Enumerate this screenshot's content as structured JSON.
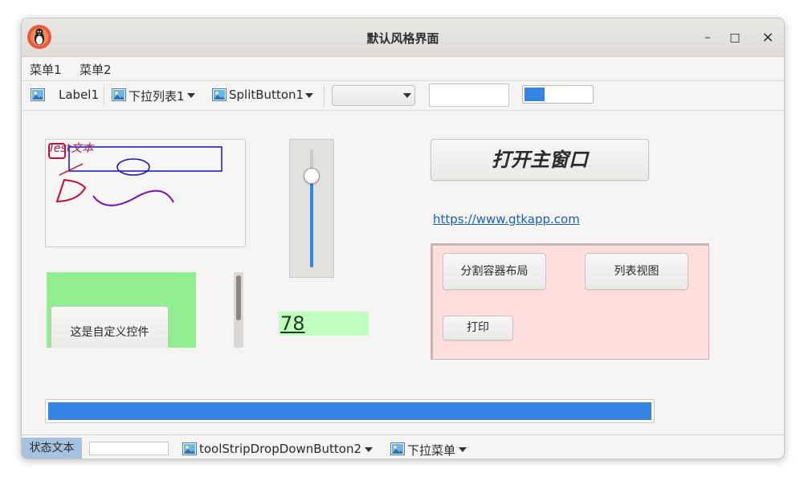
{
  "window": {
    "title": "默认风格界面",
    "minimize_glyph": "–",
    "maximize_glyph": "□",
    "close_glyph": "×"
  },
  "menubar": {
    "items": [
      "菜单1",
      "菜单2"
    ]
  },
  "toolbar": {
    "label1": "Label1",
    "dropdown1": "下拉列表1",
    "split_button1": "SplitButton1",
    "combo_value": "",
    "text_value": "",
    "progress_value": 0.3
  },
  "canvas": {
    "text": "Test文本"
  },
  "main_button": {
    "label": "打开主窗口"
  },
  "link": {
    "text": "https://www.gtkapp.com"
  },
  "panel": {
    "split_layout_button": "分割容器布局",
    "list_view_button": "列表视图",
    "print_button": "打印"
  },
  "custom_control": {
    "label": "这是自定义控件"
  },
  "numeric": {
    "value": "78"
  },
  "vertical_slider": {
    "value": 0.78
  },
  "progress_main": {
    "value": 1.0
  },
  "statusbar": {
    "status_text": "状态文本",
    "text_value": "",
    "dropdown_button2": "toolStripDropDownButton2",
    "dropdown_menu": "下拉菜单"
  },
  "colors": {
    "accent": "#3584e4",
    "panel_bg": "#ffdfdd",
    "custom_bg": "#90ee90",
    "numeric_bg": "#c0ffc0",
    "link": "#1a5fb4"
  },
  "icons": [
    "penguin-app-icon",
    "image-icon",
    "chevron-down-icon",
    "minimize-icon",
    "maximize-icon",
    "close-icon"
  ]
}
